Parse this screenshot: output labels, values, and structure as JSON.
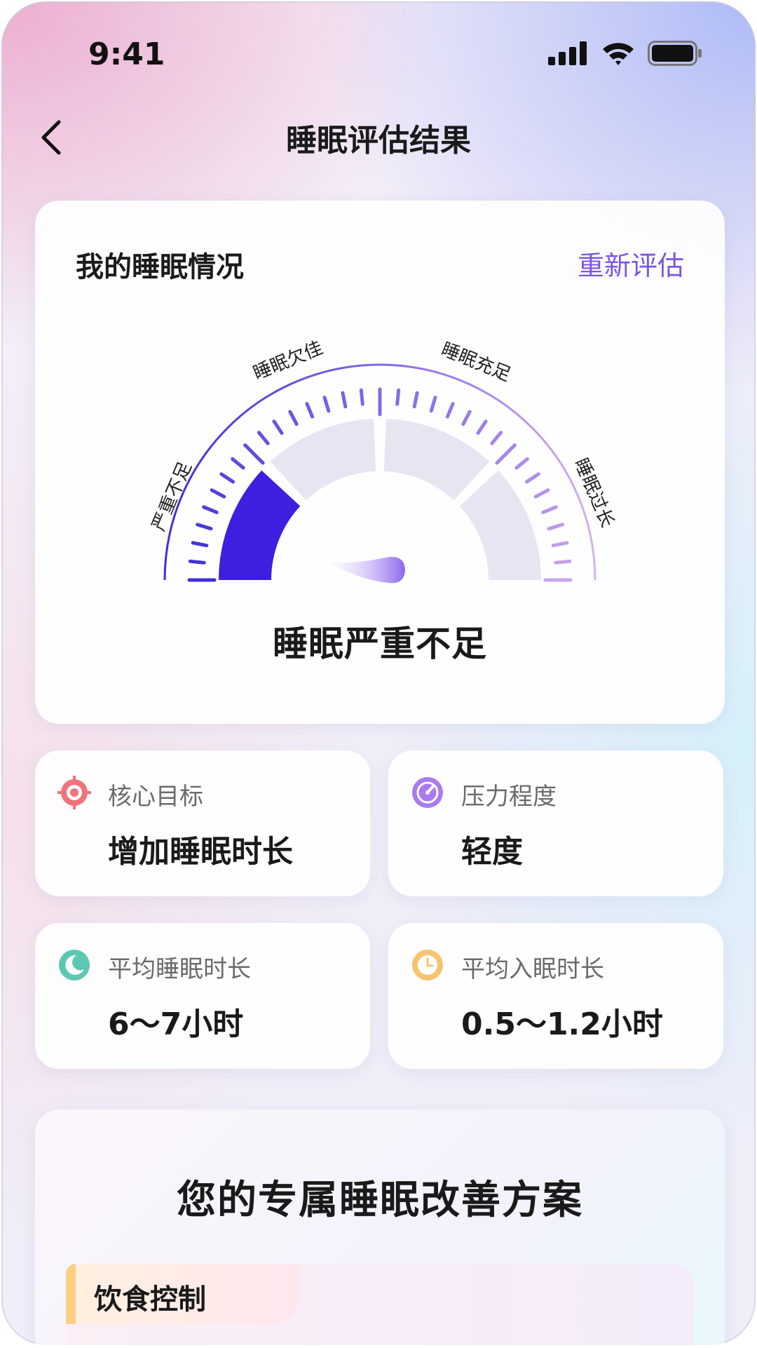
{
  "status_bar": {
    "time": "9:41"
  },
  "header": {
    "title": "睡眠评估结果"
  },
  "assessment": {
    "card_title": "我的睡眠情况",
    "reassess_label": "重新评估",
    "gauge_labels": [
      "严重不足",
      "睡眠欠佳",
      "睡眠充足",
      "睡眠过长"
    ],
    "active_segment": "严重不足",
    "result": "睡眠严重不足",
    "colors": {
      "active": "#3e1fe0",
      "inactive": "#e6e6f2",
      "arc_start": "#3d2fd8",
      "arc_end": "#c9a4f0"
    }
  },
  "stats": [
    {
      "label": "核心目标",
      "value": "增加睡眠时长",
      "icon": "target-icon",
      "color": "#f0727a"
    },
    {
      "label": "压力程度",
      "value": "轻度",
      "icon": "gauge-icon",
      "color": "#a97af0"
    },
    {
      "label": "平均睡眠时长",
      "value": "6～7小时",
      "icon": "moon-icon",
      "color": "#5cc8b4"
    },
    {
      "label": "平均入眠时长",
      "value": "0.5～1.2小时",
      "icon": "clock-icon",
      "color": "#f6c46e"
    }
  ],
  "plan": {
    "title": "您的专属睡眠改善方案",
    "section_tab": "饮食控制"
  }
}
